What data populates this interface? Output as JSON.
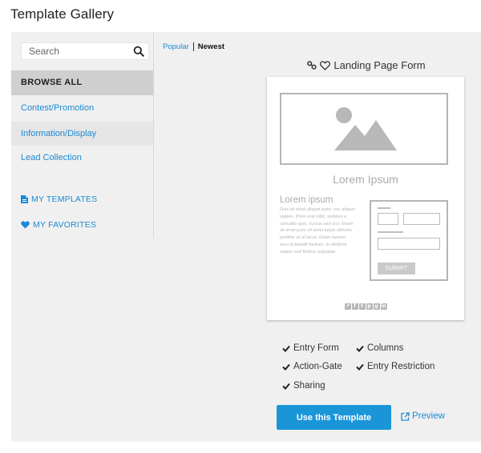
{
  "page": {
    "title": "Template Gallery"
  },
  "sidebar": {
    "search_placeholder": "Search",
    "items": [
      {
        "label": "BROWSE ALL"
      },
      {
        "label": "Contest/Promotion"
      },
      {
        "label": "Information/Display"
      },
      {
        "label": "Lead Collection"
      }
    ],
    "my_templates": "MY TEMPLATES",
    "my_favorites": "MY FAVORITES"
  },
  "sort": {
    "popular": "Popular",
    "newest": "Newest"
  },
  "template": {
    "title": "Landing Page Form",
    "preview": {
      "heading": "Lorem Ipsum",
      "subheading": "Lorem ipsum",
      "body": "Duis sit amet aliquet justo, nec aliquet sapien. Proin erat nibh, sodales a convallis quis, cursus sed orci. Etiam sit amet justo sit amet turpis ultricies porttitor ut at lacus. Etiam laoreet arcu id blandit facilisis. In eleifend sapien sed finibus vulputate.",
      "submit_label": "SUBMIT"
    },
    "features": [
      "Entry Form",
      "Columns",
      "Action-Gate",
      "Entry Restriction",
      "Sharing"
    ]
  },
  "actions": {
    "use_label": "Use this Template",
    "preview_label": "Preview"
  },
  "colors": {
    "accent": "#1a96d8",
    "link": "#1a8ad4",
    "active_bg": "#cfcfcf",
    "panel_bg": "#f0f0f0"
  }
}
